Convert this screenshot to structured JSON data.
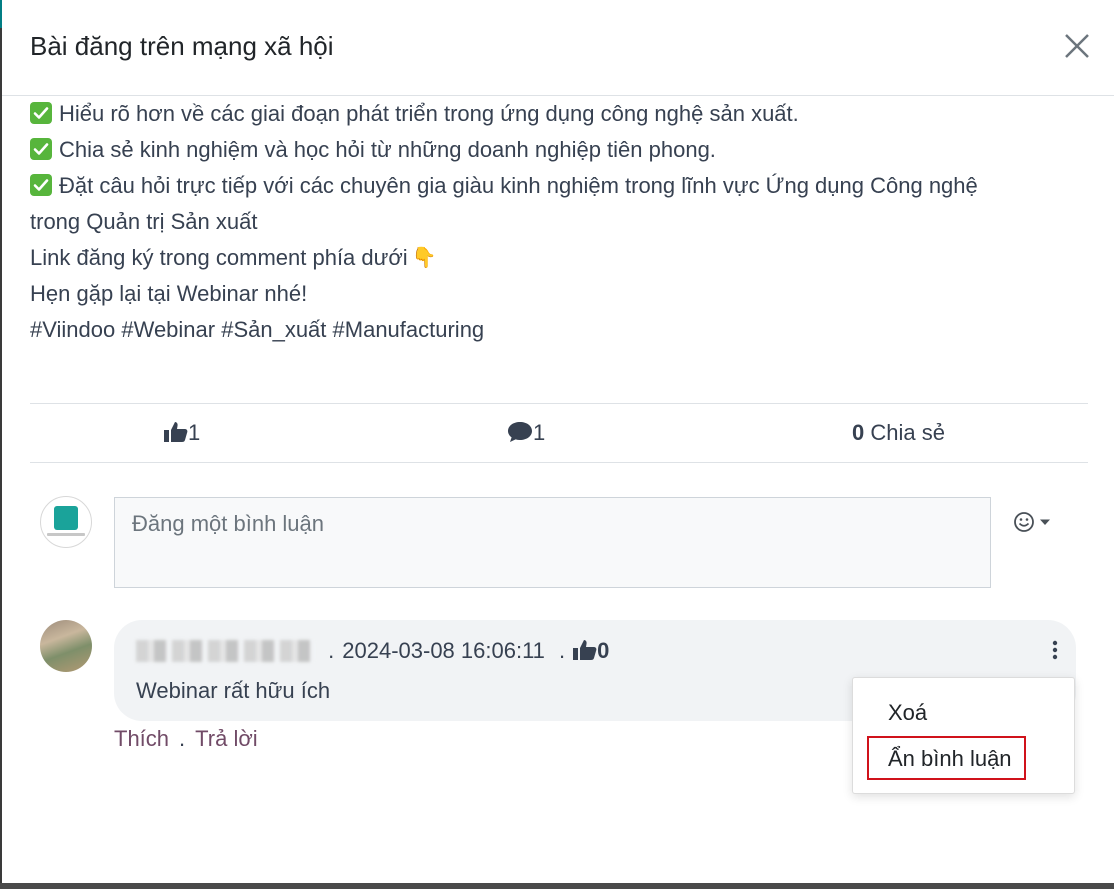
{
  "modal": {
    "title": "Bài đăng trên mạng xã hội",
    "close_icon": "close-icon"
  },
  "post": {
    "lines": [
      "Hiểu rõ hơn về các giai đoạn phát triển trong ứng dụng công nghệ sản xuất.",
      "Chia sẻ kinh nghiệm và học hỏi từ những doanh nghiệp tiên phong.",
      "Đặt câu hỏi trực tiếp với các chuyên gia giàu kinh nghiệm trong lĩnh vực Ứng dụng Công nghệ",
      "trong Quản trị Sản xuất",
      "Link đăng ký trong comment phía dưới",
      "Hẹn gặp lại tại Webinar nhé!",
      "#Viindoo #Webinar #Sản_xuất #Manufacturing"
    ],
    "pointing_emoji": "👇"
  },
  "stats": {
    "likes": "1",
    "comments": "1",
    "shares_count": "0",
    "shares_label": "Chia sẻ"
  },
  "composer": {
    "placeholder": "Đăng một bình luận",
    "emoji_icon": "smiley-icon"
  },
  "comment": {
    "author": "",
    "timestamp": "2024-03-08 16:06:11",
    "likes": "0",
    "text": "Webinar rất hữu ích",
    "like_action": "Thích",
    "reply_action": "Trả lời",
    "separator": "."
  },
  "menu": {
    "items": [
      "Xoá",
      "Ẩn bình luận"
    ],
    "highlight_color": "#d0121b"
  },
  "colors": {
    "link": "#714b67",
    "check": "#57b53c",
    "bubble": "#f1f3f5"
  }
}
